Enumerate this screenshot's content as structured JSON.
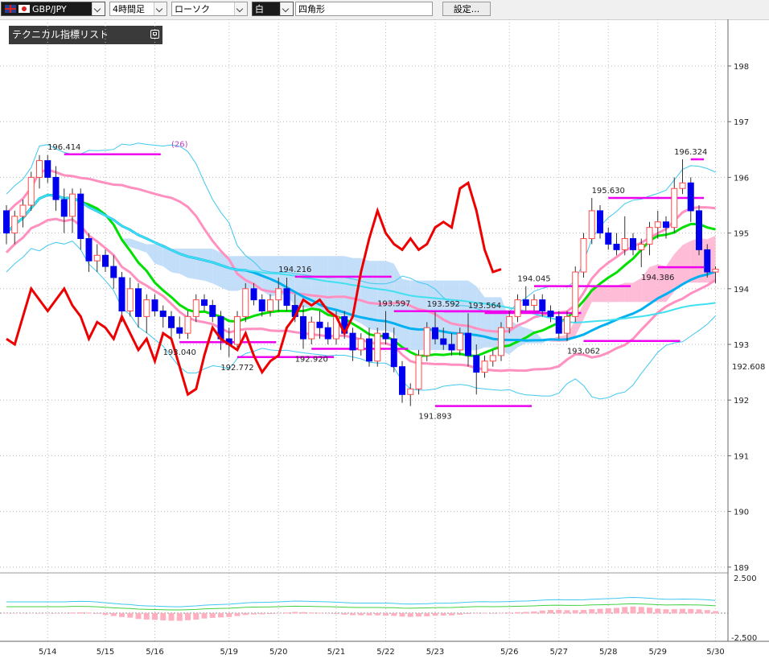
{
  "toolbar": {
    "symbol": "GBP/JPY",
    "timeframe": "4時間足",
    "chart_style": "ローソク",
    "color_mode": "白",
    "shape": "四角形",
    "settings_label": "設定..."
  },
  "indicator_panel": {
    "title": "テクニカル指標リスト"
  },
  "colors": {
    "bull_candle": "#ff4a4a",
    "bear_candle": "#0000ee",
    "cloud_bull": "#ffb0d0",
    "cloud_bear": "#b8d8f8",
    "ma_short": "#00e000",
    "ma_mid": "#00b0f0",
    "ma_long": "#40e0f0",
    "bb_sigma1": "#ff90c0",
    "bb_sigma2": "#40c8f0",
    "chikou": "#ee0000",
    "horizontal_lines": "#ee00ee"
  },
  "chart_data": {
    "type": "candlestick",
    "price_axis": {
      "ticks": [
        "198",
        "197",
        "196",
        "195",
        "194",
        "193",
        "192",
        "191",
        "190",
        "189"
      ],
      "current_price_label": "192.608",
      "ylim": [
        188.8,
        198.4
      ]
    },
    "oscillator_axis": {
      "ticks": [
        "2.500",
        "-2.500"
      ]
    },
    "x_ticks": [
      "5/14",
      "5/15",
      "5/16",
      "5/19",
      "5/20",
      "5/21",
      "5/22",
      "5/23",
      "5/26",
      "5/27",
      "5/28",
      "5/29",
      "5/30"
    ],
    "annotations": [
      {
        "text": "196.414",
        "x": 7,
        "price": 196.414,
        "pos": "above"
      },
      {
        "text": "193.040",
        "x": 21,
        "price": 193.04,
        "pos": "below"
      },
      {
        "text": "192.772",
        "x": 28,
        "price": 192.772,
        "pos": "below"
      },
      {
        "text": "194.216",
        "x": 35,
        "price": 194.216,
        "pos": "above"
      },
      {
        "text": "192.920",
        "x": 37,
        "price": 192.92,
        "pos": "below"
      },
      {
        "text": "193.597",
        "x": 47,
        "price": 193.597,
        "pos": "above"
      },
      {
        "text": "191.893",
        "x": 52,
        "price": 191.893,
        "pos": "below"
      },
      {
        "text": "193.592",
        "x": 53,
        "price": 193.592,
        "pos": "above"
      },
      {
        "text": "193.564",
        "x": 58,
        "price": 193.564,
        "pos": "above"
      },
      {
        "text": "194.045",
        "x": 64,
        "price": 194.045,
        "pos": "above"
      },
      {
        "text": "193.062",
        "x": 70,
        "price": 193.062,
        "pos": "below"
      },
      {
        "text": "195.630",
        "x": 73,
        "price": 195.63,
        "pos": "above"
      },
      {
        "text": "194.386",
        "x": 79,
        "price": 194.386,
        "pos": "below"
      },
      {
        "text": "196.324",
        "x": 83,
        "price": 196.324,
        "pos": "above"
      },
      {
        "text": "(26)",
        "x": 21,
        "price": 196.55,
        "pos": "label"
      }
    ],
    "candles": [
      [
        195.4,
        195.5,
        194.8,
        195.0
      ],
      [
        195.0,
        195.4,
        194.8,
        195.3
      ],
      [
        195.3,
        195.6,
        195.1,
        195.5
      ],
      [
        195.5,
        196.1,
        195.4,
        196.0
      ],
      [
        196.0,
        196.4,
        195.8,
        196.3
      ],
      [
        196.3,
        196.4,
        195.9,
        196.0
      ],
      [
        196.0,
        196.2,
        195.4,
        195.6
      ],
      [
        195.6,
        195.8,
        195.0,
        195.3
      ],
      [
        195.3,
        195.8,
        195.0,
        195.7
      ],
      [
        195.7,
        195.8,
        194.7,
        194.9
      ],
      [
        194.9,
        195.0,
        194.3,
        194.5
      ],
      [
        194.5,
        194.8,
        194.3,
        194.6
      ],
      [
        194.6,
        194.7,
        194.3,
        194.4
      ],
      [
        194.4,
        194.6,
        194.0,
        194.2
      ],
      [
        194.2,
        194.3,
        193.4,
        193.6
      ],
      [
        193.6,
        194.2,
        193.5,
        194.0
      ],
      [
        194.0,
        194.1,
        193.3,
        193.5
      ],
      [
        193.5,
        193.9,
        193.2,
        193.8
      ],
      [
        193.8,
        193.9,
        193.5,
        193.6
      ],
      [
        193.6,
        193.7,
        193.3,
        193.5
      ],
      [
        193.5,
        193.6,
        193.04,
        193.3
      ],
      [
        193.3,
        193.5,
        193.1,
        193.2
      ],
      [
        193.2,
        193.6,
        193.1,
        193.5
      ],
      [
        193.5,
        193.9,
        193.4,
        193.8
      ],
      [
        193.8,
        193.9,
        193.6,
        193.7
      ],
      [
        193.7,
        193.8,
        193.4,
        193.5
      ],
      [
        193.5,
        193.6,
        192.9,
        193.1
      ],
      [
        193.1,
        193.3,
        192.772,
        193.0
      ],
      [
        193.0,
        193.6,
        192.9,
        193.5
      ],
      [
        193.5,
        194.1,
        193.4,
        194.0
      ],
      [
        194.0,
        194.1,
        193.7,
        193.8
      ],
      [
        193.8,
        193.9,
        193.5,
        193.6
      ],
      [
        193.6,
        193.9,
        193.5,
        193.8
      ],
      [
        193.8,
        194.2,
        193.6,
        194.0
      ],
      [
        194.0,
        194.2,
        193.6,
        193.7
      ],
      [
        193.7,
        193.9,
        193.4,
        193.5
      ],
      [
        193.5,
        193.7,
        192.92,
        193.1
      ],
      [
        193.1,
        193.5,
        193.0,
        193.4
      ],
      [
        193.4,
        193.6,
        193.1,
        193.3
      ],
      [
        193.3,
        193.4,
        193.0,
        193.1
      ],
      [
        193.1,
        193.6,
        193.0,
        193.5
      ],
      [
        193.5,
        193.6,
        193.1,
        193.2
      ],
      [
        193.2,
        193.3,
        192.7,
        192.9
      ],
      [
        192.9,
        193.2,
        192.8,
        193.1
      ],
      [
        193.1,
        193.3,
        192.6,
        192.7
      ],
      [
        192.7,
        193.3,
        192.6,
        193.2
      ],
      [
        193.2,
        193.6,
        193.0,
        193.1
      ],
      [
        193.1,
        193.3,
        192.5,
        192.6
      ],
      [
        192.6,
        192.7,
        191.95,
        192.1
      ],
      [
        192.1,
        192.3,
        191.893,
        192.2
      ],
      [
        192.2,
        192.9,
        192.1,
        192.8
      ],
      [
        192.8,
        193.4,
        192.7,
        193.3
      ],
      [
        193.3,
        193.59,
        193.0,
        193.1
      ],
      [
        193.1,
        193.3,
        192.9,
        193.0
      ],
      [
        193.0,
        193.2,
        192.8,
        192.9
      ],
      [
        192.9,
        193.3,
        192.8,
        193.2
      ],
      [
        193.2,
        193.56,
        192.6,
        192.8
      ],
      [
        192.8,
        193.0,
        192.1,
        192.5
      ],
      [
        192.5,
        192.8,
        192.4,
        192.7
      ],
      [
        192.7,
        192.9,
        192.6,
        192.8
      ],
      [
        192.8,
        193.4,
        192.7,
        193.3
      ],
      [
        193.3,
        193.6,
        193.2,
        193.5
      ],
      [
        193.5,
        193.9,
        193.4,
        193.8
      ],
      [
        193.8,
        194.045,
        193.6,
        193.7
      ],
      [
        193.7,
        193.9,
        193.6,
        193.8
      ],
      [
        193.8,
        193.9,
        193.5,
        193.6
      ],
      [
        193.6,
        193.7,
        193.4,
        193.5
      ],
      [
        193.5,
        193.6,
        193.1,
        193.2
      ],
      [
        193.2,
        193.6,
        193.062,
        193.5
      ],
      [
        193.5,
        194.4,
        193.4,
        194.3
      ],
      [
        194.3,
        195.0,
        194.2,
        194.9
      ],
      [
        194.9,
        195.63,
        194.8,
        195.4
      ],
      [
        195.4,
        195.5,
        194.9,
        195.0
      ],
      [
        195.0,
        195.1,
        194.7,
        194.8
      ],
      [
        194.8,
        195.0,
        194.6,
        194.7
      ],
      [
        194.7,
        195.3,
        194.6,
        194.9
      ],
      [
        194.9,
        195.0,
        194.6,
        194.7
      ],
      [
        194.7,
        194.9,
        194.386,
        194.8
      ],
      [
        194.8,
        195.2,
        194.6,
        195.1
      ],
      [
        195.1,
        195.4,
        194.9,
        195.2
      ],
      [
        195.2,
        195.3,
        194.9,
        195.1
      ],
      [
        195.1,
        196.0,
        195.0,
        195.8
      ],
      [
        195.8,
        196.324,
        195.7,
        195.9
      ],
      [
        195.9,
        196.0,
        195.2,
        195.4
      ],
      [
        195.4,
        195.5,
        194.6,
        194.7
      ],
      [
        194.7,
        194.8,
        194.2,
        194.3
      ],
      [
        194.3,
        194.4,
        194.1,
        194.35
      ]
    ]
  }
}
